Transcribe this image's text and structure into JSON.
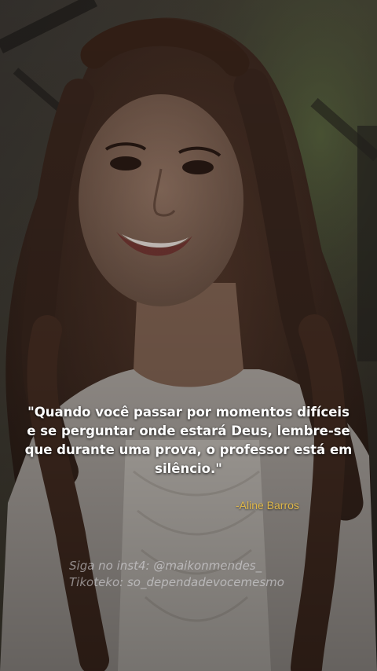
{
  "quote": {
    "line1": "\"Quando você passar por momentos difíceis",
    "line2": "e se perguntar onde estará Deus, lembre-se",
    "line3": "que durante uma prova, o professor está em",
    "line4": "silêncio.\""
  },
  "author": "-Aline Barros",
  "credits": {
    "instagram": "Siga no inst4: @maikonmendes_",
    "tiktok": "Tikoteko: so_dependadevocemesmo"
  },
  "colors": {
    "quote_text": "#ffffff",
    "author_text": "#e0b84a",
    "credits_text": "#e6e6eb"
  }
}
